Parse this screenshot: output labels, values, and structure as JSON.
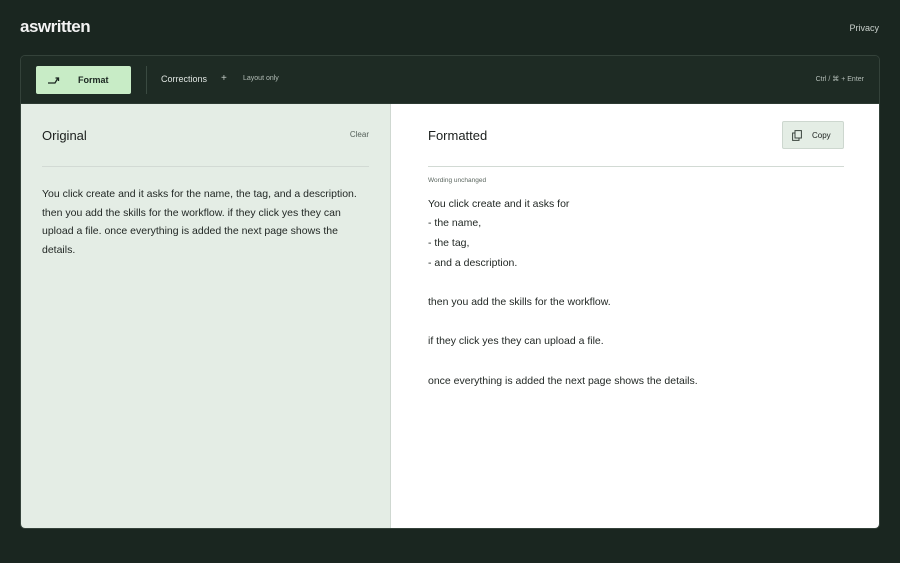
{
  "app": {
    "logo": "aswritten",
    "privacy_link": "Privacy"
  },
  "toolbar": {
    "format_label": "Format",
    "format_icon": "format-arrow-icon",
    "corrections_label": "Corrections",
    "plus_label": "+",
    "layout_only_label": "Layout only",
    "shortcut": "Ctrl / ⌘ + Enter"
  },
  "original": {
    "title": "Original",
    "clear_label": "Clear",
    "text": "You click create and it asks for the name, the tag, and a description. then you add the skills for the workflow. if they click yes they can upload a file. once everything is added the next page shows the details."
  },
  "formatted": {
    "title": "Formatted",
    "copy_label": "Copy",
    "copy_icon": "copy-icon",
    "status": "Wording unchanged",
    "lines": [
      "You click create and it asks for",
      "- the name,",
      "- the tag,",
      "- and a description.",
      "then you add the skills for the workflow.",
      "if they click yes they can upload a file.",
      "once everything is added the next page shows the details."
    ]
  },
  "colors": {
    "background": "#1a2620",
    "accent": "#c8ecc6",
    "left_pane": "#e4ede5",
    "right_pane": "#ffffff"
  }
}
